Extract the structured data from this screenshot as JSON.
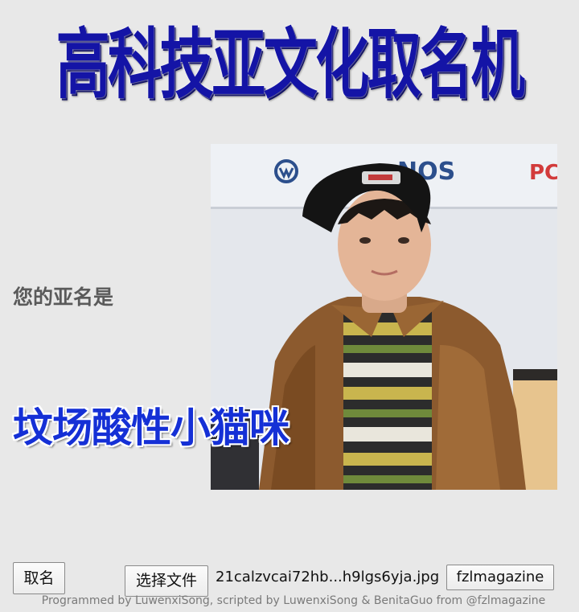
{
  "app": {
    "title": "高科技亚文化取名机"
  },
  "result": {
    "prefix": "您的亚名是",
    "name": "坟场酸性小猫咪"
  },
  "photo": {
    "background_sign_text": "NOS",
    "background_sign_partial": "PC"
  },
  "controls": {
    "generate_label": "取名",
    "choose_file_label": "选择文件",
    "selected_file_name": "21calzvcai72hb...h9lgs6yja.jpg",
    "brand_label": "fzlmagazine"
  },
  "footer": {
    "credit": "Programmed by LuwenxiSong, scripted by LuwenxiSong & BenitaGuo from @fzlmagazine"
  },
  "colors": {
    "title": "#1414a6",
    "result_name": "#1530d6",
    "background": "#e8e8e8"
  }
}
